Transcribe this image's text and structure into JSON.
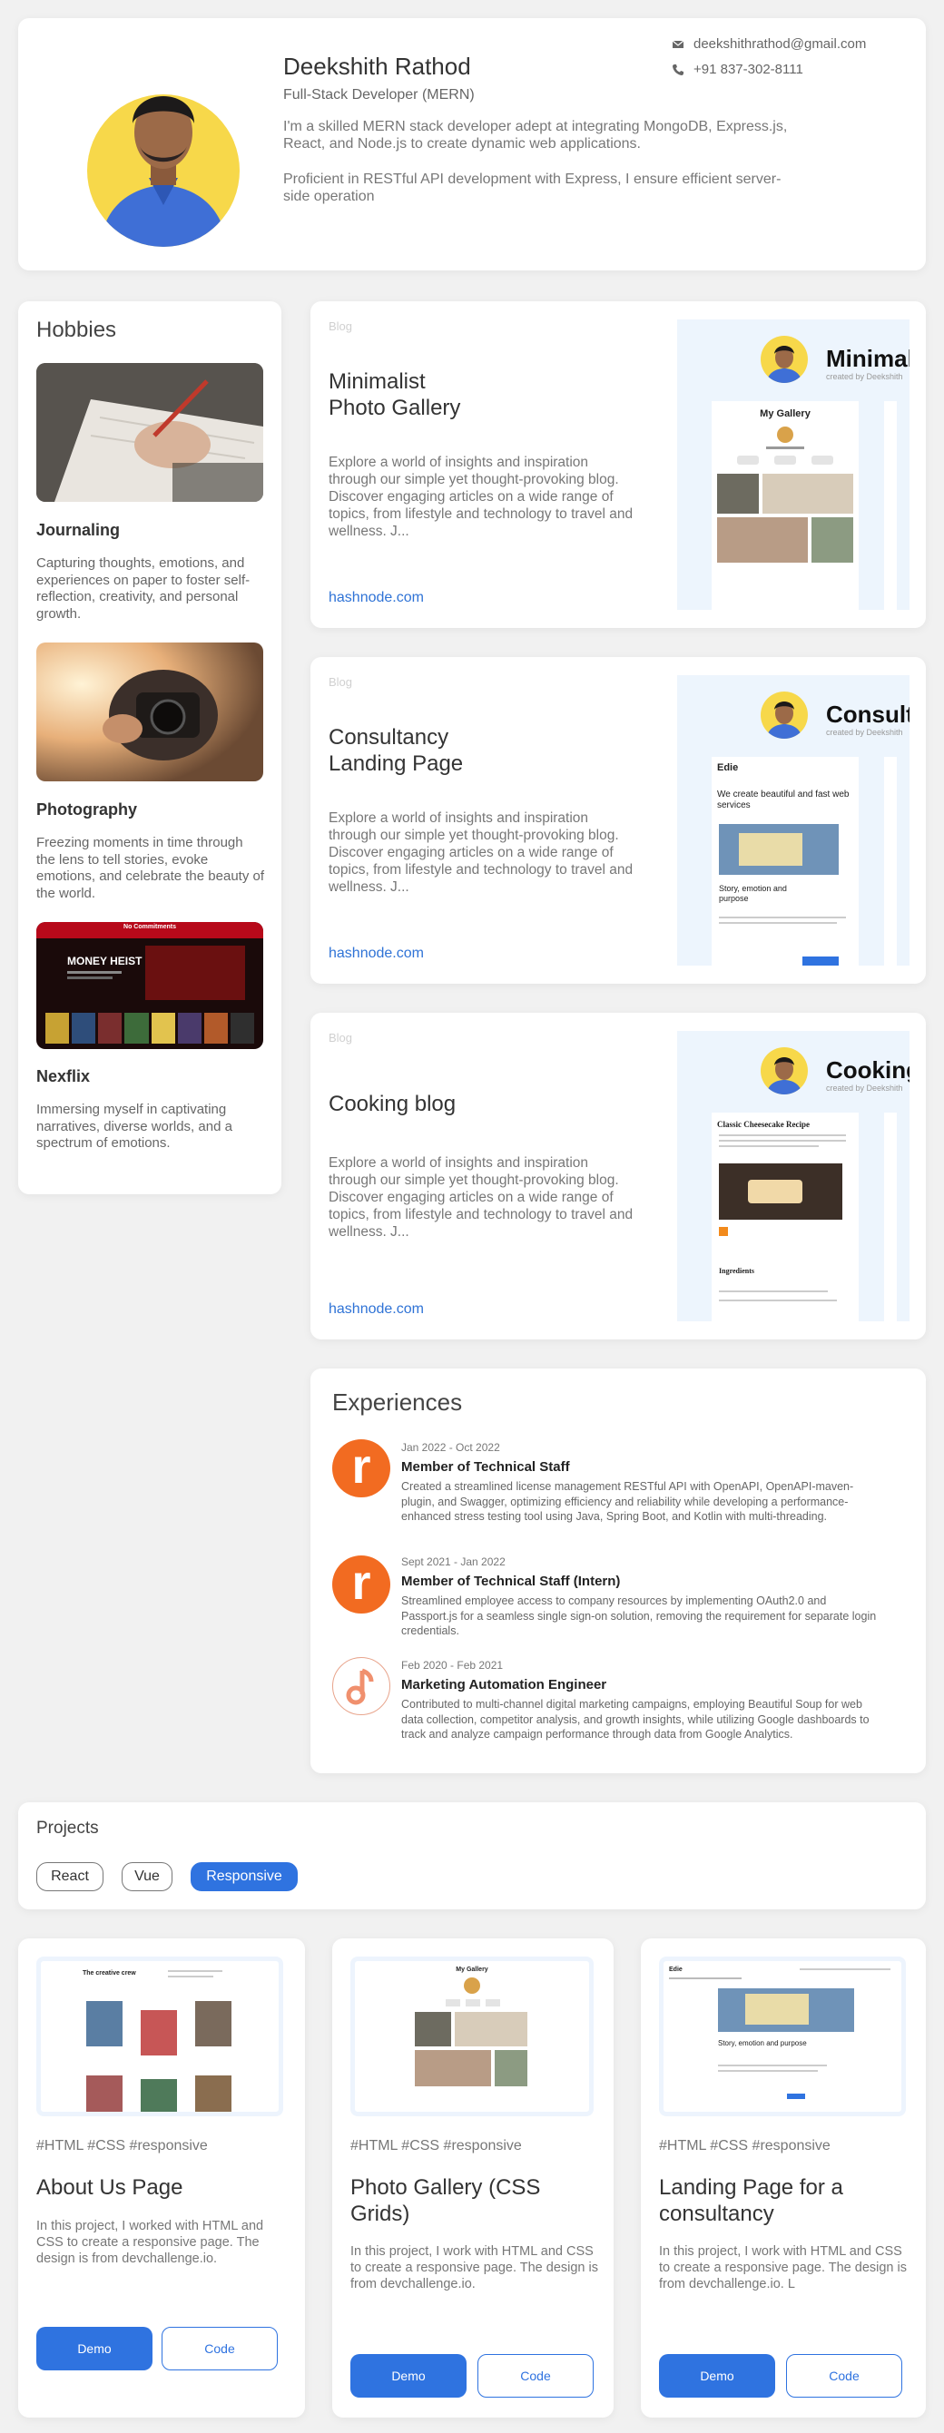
{
  "profile": {
    "name": "Deekshith Rathod",
    "role": "Full-Stack Developer (MERN)",
    "bio1": "I'm a skilled MERN stack developer adept at integrating MongoDB, Express.js, React, and Node.js to create dynamic web applications.",
    "bio2": "Proficient in RESTful API development with Express, I ensure efficient server-side operation",
    "email": "deekshithrathod@gmail.com",
    "phone": "+91 837-302-8111"
  },
  "hobbies": {
    "title": "Hobbies",
    "items": [
      {
        "name": "Journaling",
        "desc": "Capturing thoughts, emotions, and experiences on paper to foster self-reflection, creativity, and personal growth."
      },
      {
        "name": "Photography",
        "desc": "Freezing moments in time through the lens to tell stories, evoke emotions, and celebrate the beauty of the world."
      },
      {
        "name": "Nexflix",
        "desc": "Immersing myself in captivating narratives, diverse worlds, and a spectrum of emotions.",
        "banner_heading": "No Commitments",
        "show_title": "MONEY HEIST"
      }
    ]
  },
  "blogs": [
    {
      "tag": "Blog",
      "title_line1": "Minimalist",
      "title_line2": "Photo Gallery",
      "desc": "Explore a world of insights and inspiration through our simple yet thought-provoking blog. Discover engaging articles on a wide range of topics, from lifestyle and technology to travel and wellness. J...",
      "link": "hashnode.com",
      "shot_title": "Minimal",
      "shot_sub": "created by Deekshith",
      "shot_heading": "My Gallery"
    },
    {
      "tag": "Blog",
      "title_line1": "Consultancy",
      "title_line2": "Landing Page",
      "desc": "Explore a world of insights and inspiration through our simple yet thought-provoking blog. Discover engaging articles on a wide range of topics, from lifestyle and technology to travel and wellness. J...",
      "link": "hashnode.com",
      "shot_title": "Consult",
      "shot_sub": "created by Deekshith",
      "shot_brand": "Edie",
      "shot_heading": "We create beautiful and fast web services",
      "shot_sub2": "Story, emotion and purpose"
    },
    {
      "tag": "Blog",
      "title_line1": "Cooking blog",
      "title_line2": "",
      "desc": "Explore a world of insights and inspiration through our simple yet thought-provoking blog. Discover engaging articles on a wide range of topics, from lifestyle and technology to travel and wellness. J...",
      "link": "hashnode.com",
      "shot_title": "Cooking",
      "shot_sub": "created by Deekshith",
      "shot_heading": "Classic Cheesecake Recipe",
      "shot_sub2": "Ingredients"
    }
  ],
  "experiences": {
    "title": "Experiences",
    "items": [
      {
        "date": "Jan 2022 - Oct 2022",
        "role": "Member of Technical Staff",
        "desc": "Created a streamlined license management RESTful API with OpenAPI, OpenAPI-maven-plugin, and Swagger, optimizing efficiency and reliability while developing a performance-enhanced stress testing tool using Java, Spring Boot, and Kotlin with multi-threading.",
        "logo_letter": "r"
      },
      {
        "date": "Sept 2021 - Jan 2022",
        "role": "Member of Technical Staff (Intern)",
        "desc": "Streamlined employee access to company resources by implementing OAuth2.0 and Passport.js for a seamless single sign-on solution, removing the requirement for separate login credentials.",
        "logo_letter": "r"
      },
      {
        "date": "Feb 2020 - Feb 2021",
        "role": "Marketing Automation Engineer",
        "desc": "Contributed to multi-channel digital marketing campaigns, employing Beautiful Soup for web data collection, competitor analysis, and growth insights, while utilizing Google dashboards to track and analyze campaign performance through data from Google Analytics.",
        "logo_letter": ""
      }
    ]
  },
  "projects": {
    "title": "Projects",
    "filters": [
      {
        "label": "React",
        "active": false
      },
      {
        "label": "Vue",
        "active": false
      },
      {
        "label": "Responsive",
        "active": true
      }
    ],
    "cards": [
      {
        "tags": "#HTML #CSS #responsive",
        "title": "About Us Page",
        "desc": "In this project, I worked with HTML and CSS to create a responsive page. The design is from devchallenge.io.",
        "demo": "Demo",
        "code": "Code",
        "shot_heading": "The creative crew"
      },
      {
        "tags": "#HTML #CSS #responsive",
        "title": "Photo Gallery (CSS Grids)",
        "desc": "In this project, I work with HTML and CSS to create a responsive page. The design is from devchallenge.io.",
        "demo": "Demo",
        "code": "Code",
        "shot_heading": "My Gallery"
      },
      {
        "tags": "#HTML #CSS #responsive",
        "title": "Landing Page for a consultancy",
        "desc": "In this project, I work with HTML and CSS to create a responsive page. The design is from devchallenge.io. L",
        "demo": "Demo",
        "code": "Code",
        "shot_heading": "Edie",
        "shot_sub": "Story, emotion and purpose"
      }
    ]
  },
  "colors": {
    "accent": "#2f73e0",
    "link": "#2f73e0",
    "avatar_bg": "#f7d84a",
    "exp_logo": "#f26b21"
  }
}
